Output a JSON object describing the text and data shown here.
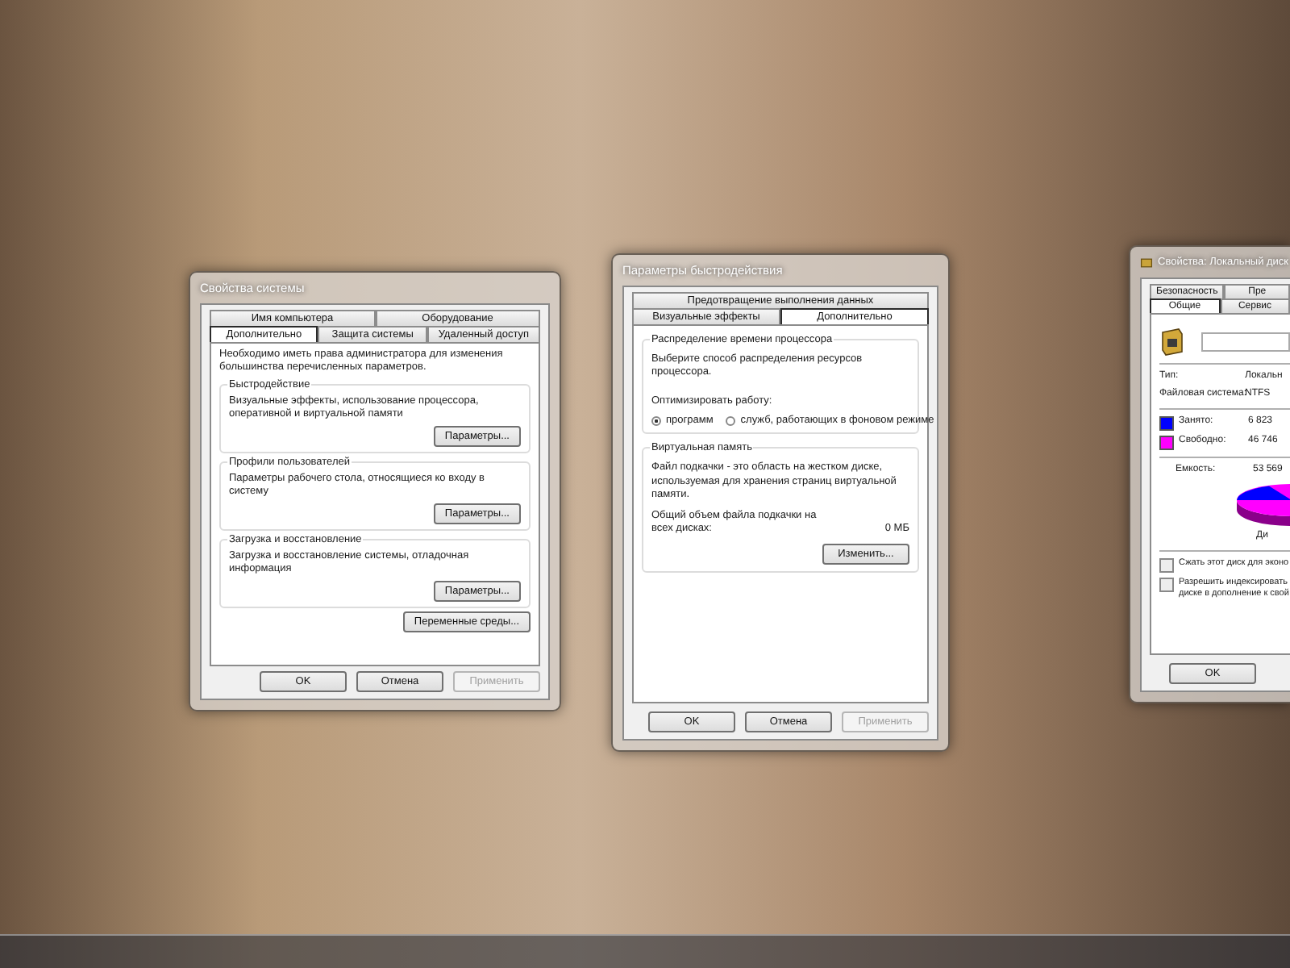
{
  "system_properties": {
    "title": "Свойства системы",
    "tab_rows": [
      [
        {
          "label": "Имя компьютера",
          "selected": false
        },
        {
          "label": "Оборудование",
          "selected": false
        }
      ],
      [
        {
          "label": "Дополнительно",
          "selected": true
        },
        {
          "label": "Защита системы",
          "selected": false
        },
        {
          "label": "Удаленный доступ",
          "selected": false
        }
      ]
    ],
    "notice": "Необходимо иметь права администратора для изменения большинства перечисленных параметров.",
    "groups": [
      {
        "title": "Быстродействие",
        "text": "Визуальные эффекты, использование процессора, оперативной и виртуальной памяти",
        "button": "Параметры..."
      },
      {
        "title": "Профили пользователей",
        "text": "Параметры рабочего стола, относящиеся ко входу в систему",
        "button": "Параметры..."
      },
      {
        "title": "Загрузка и восстановление",
        "text": "Загрузка и восстановление системы, отладочная информация",
        "button": "Параметры..."
      }
    ],
    "env_button": "Переменные среды...",
    "buttons": [
      {
        "label": "OK",
        "disabled": false
      },
      {
        "label": "Отмена",
        "disabled": false
      },
      {
        "label": "Применить",
        "disabled": true
      }
    ]
  },
  "performance_options": {
    "title": "Параметры быстродействия",
    "tab_rows": [
      [
        {
          "label": "Предотвращение выполнения данных",
          "selected": false
        }
      ],
      [
        {
          "label": "Визуальные эффекты",
          "selected": false
        },
        {
          "label": "Дополнительно",
          "selected": true
        }
      ]
    ],
    "processor": {
      "title": "Распределение времени процессора",
      "text": "Выберите способ распределения ресурсов процессора.",
      "prompt": "Оптимизировать работу:",
      "options": [
        {
          "label": "программ",
          "selected": true
        },
        {
          "label": "служб, работающих в фоновом режиме",
          "selected": false
        }
      ]
    },
    "virtual_memory": {
      "title": "Виртуальная память",
      "text": "Файл подкачки - это область на жестком диске, используемая для хранения страниц виртуальной памяти.",
      "total_label": "Общий объем файла подкачки на всех дисках:",
      "total_value": "0 МБ",
      "button": "Изменить..."
    },
    "buttons": [
      {
        "label": "OK",
        "disabled": false
      },
      {
        "label": "Отмена",
        "disabled": false
      },
      {
        "label": "Применить",
        "disabled": true
      }
    ]
  },
  "disk_properties": {
    "title": "Свойства: Локальный диск",
    "tab_rows": [
      [
        {
          "label": "Безопасность",
          "selected": false
        },
        {
          "label": "Пре",
          "selected": false
        }
      ],
      [
        {
          "label": "Общие",
          "selected": true
        },
        {
          "label": "Сервис",
          "selected": false
        }
      ]
    ],
    "fields": [
      {
        "label": "Тип:",
        "value": "Локальн"
      },
      {
        "label": "Файловая система:",
        "value": "NTFS"
      }
    ],
    "usage": [
      {
        "label": "Занято:",
        "value": "6 823",
        "color": "#0000ff"
      },
      {
        "label": "Свободно:",
        "value": "46 746",
        "color": "#ff00ff"
      }
    ],
    "capacity": {
      "label": "Емкость:",
      "value": "53 569"
    },
    "disk_label": "Ди",
    "options": [
      {
        "label": "Сжать этот диск для эконо",
        "checked": false
      },
      {
        "label": "Разрешить индексировать\nдиске в дополнение к свой",
        "checked": false
      }
    ],
    "buttons": [
      {
        "label": "OK",
        "disabled": false
      }
    ]
  }
}
